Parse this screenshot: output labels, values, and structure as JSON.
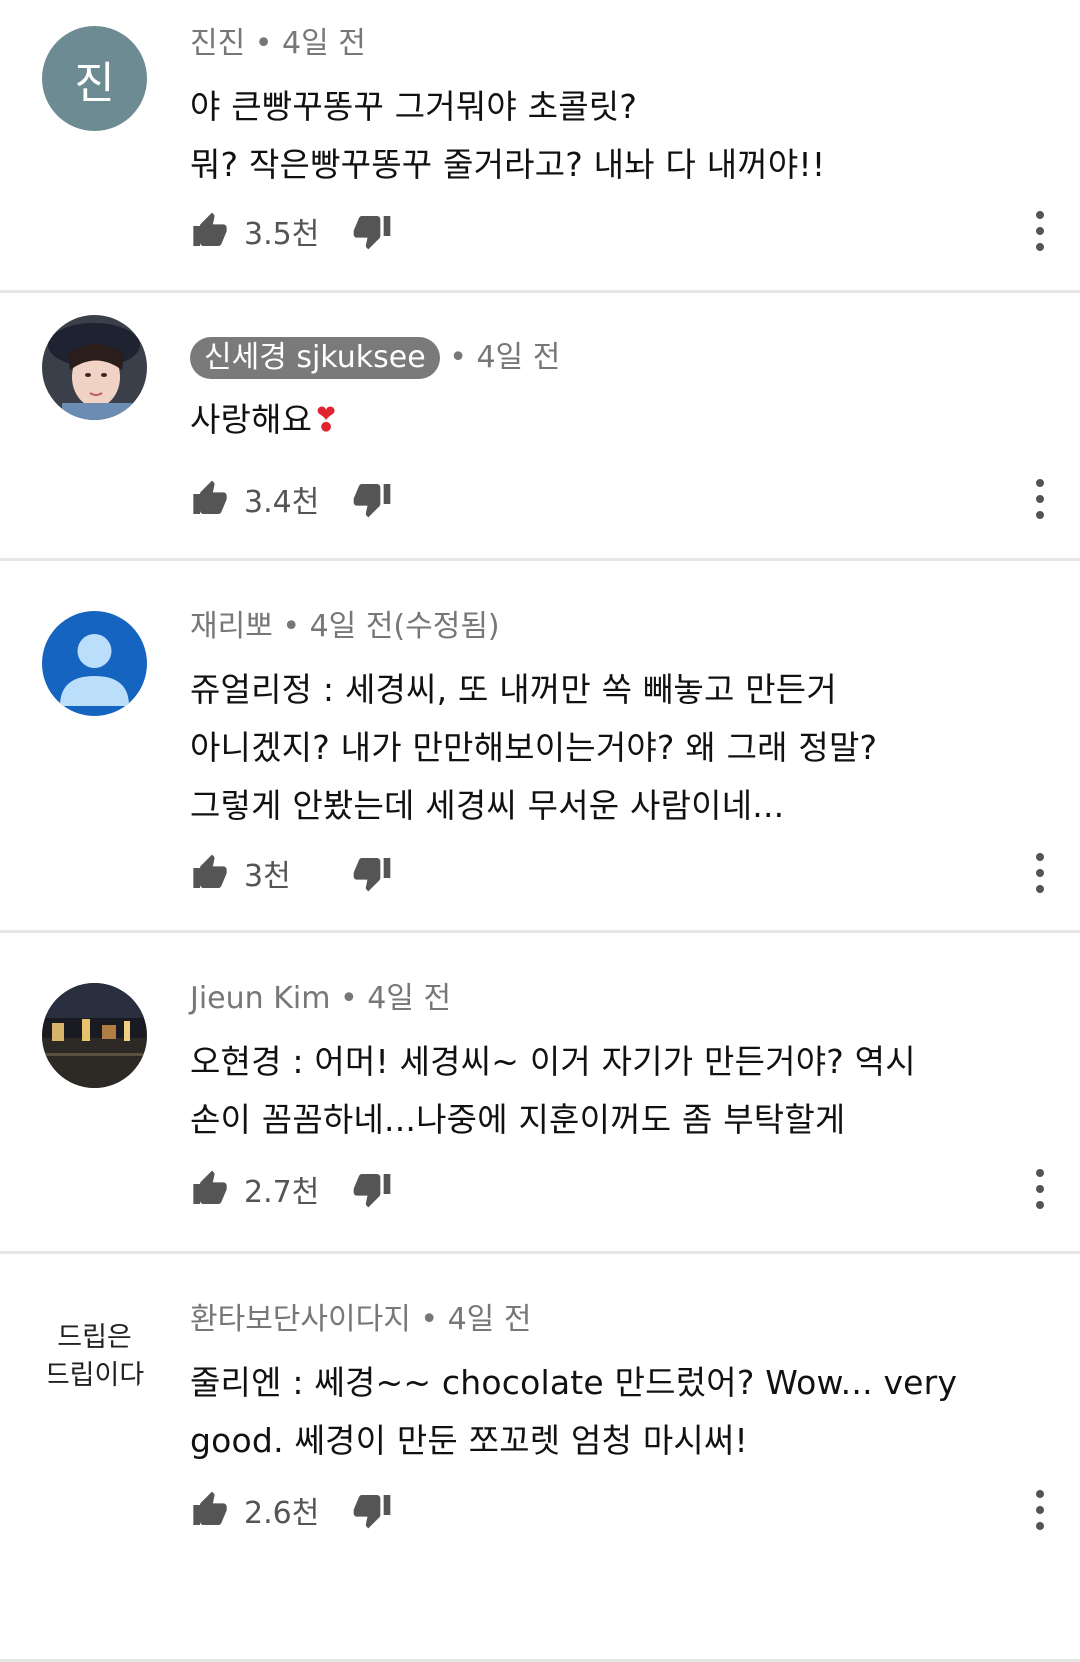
{
  "comments": [
    {
      "avatar": {
        "type": "initial",
        "text": "진"
      },
      "author": "진진",
      "time": "4일 전",
      "text": "야 큰빵꾸똥꾸 그거뭐야 초콜릿?\n뭐? 작은빵꾸똥꾸 줄거라고? 내놔 다 내꺼야!!",
      "likes": "3.5천"
    },
    {
      "avatar": {
        "type": "photo"
      },
      "author": "신세경 sjkuksee",
      "author_highlighted": true,
      "time": "4일 전",
      "text": "사랑해요",
      "emoji": "❣",
      "likes": "3.4천"
    },
    {
      "avatar": {
        "type": "default"
      },
      "author": "재리뽀",
      "time": "4일 전(수정됨)",
      "text": "쥬얼리정 : 세경씨, 또 내꺼만 쏙 빼놓고 만든거\n아니겠지? 내가 만만해보이는거야? 왜 그래 정말?\n그렇게 안봤는데 세경씨 무서운 사람이네...",
      "likes": "3천"
    },
    {
      "avatar": {
        "type": "night-photo"
      },
      "author": "Jieun Kim",
      "time": "4일 전",
      "text": "오현경 : 어머! 세경씨~ 이거 자기가 만든거야? 역시\n손이 꼼꼼하네...나중에 지훈이꺼도 좀 부탁할게",
      "likes": "2.7천"
    },
    {
      "avatar": {
        "type": "text",
        "text": "드립은\n드립이다"
      },
      "author": "환타보단사이다지",
      "time": "4일 전",
      "text": "줄리엔 : 쎄경~~ chocolate 만드렀어? Wow... very\ngood. 쎄경이 만둔 쪼꼬렛 엄청 마시써!",
      "likes": "2.6천"
    }
  ]
}
